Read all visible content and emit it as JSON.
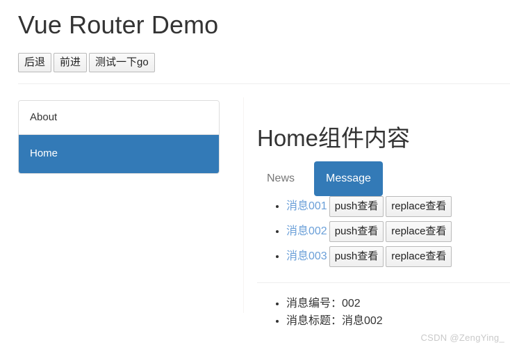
{
  "header": {
    "title": "Vue Router Demo",
    "nav_buttons": [
      {
        "label": "后退",
        "name": "back-button"
      },
      {
        "label": "前进",
        "name": "forward-button"
      },
      {
        "label": "测试一下go",
        "name": "test-go-button"
      }
    ]
  },
  "sidebar": {
    "items": [
      {
        "label": "About",
        "active": false
      },
      {
        "label": "Home",
        "active": true
      }
    ]
  },
  "main": {
    "panel_title": "Home组件内容",
    "tabs": [
      {
        "label": "News",
        "active": false
      },
      {
        "label": "Message",
        "active": true
      }
    ],
    "messages": [
      {
        "link": "消息001",
        "push_label": "push查看",
        "replace_label": "replace查看"
      },
      {
        "link": "消息002",
        "push_label": "push查看",
        "replace_label": "replace查看"
      },
      {
        "link": "消息003",
        "push_label": "push查看",
        "replace_label": "replace查看"
      }
    ],
    "detail": [
      "消息编号：002",
      "消息标题：消息002"
    ]
  },
  "watermark": "CSDN @ZengYing_",
  "colors": {
    "primary": "#337ab7",
    "link": "#6a9fd8",
    "text": "#333333",
    "border": "#dddddd",
    "watermark": "#c9c9c9"
  }
}
